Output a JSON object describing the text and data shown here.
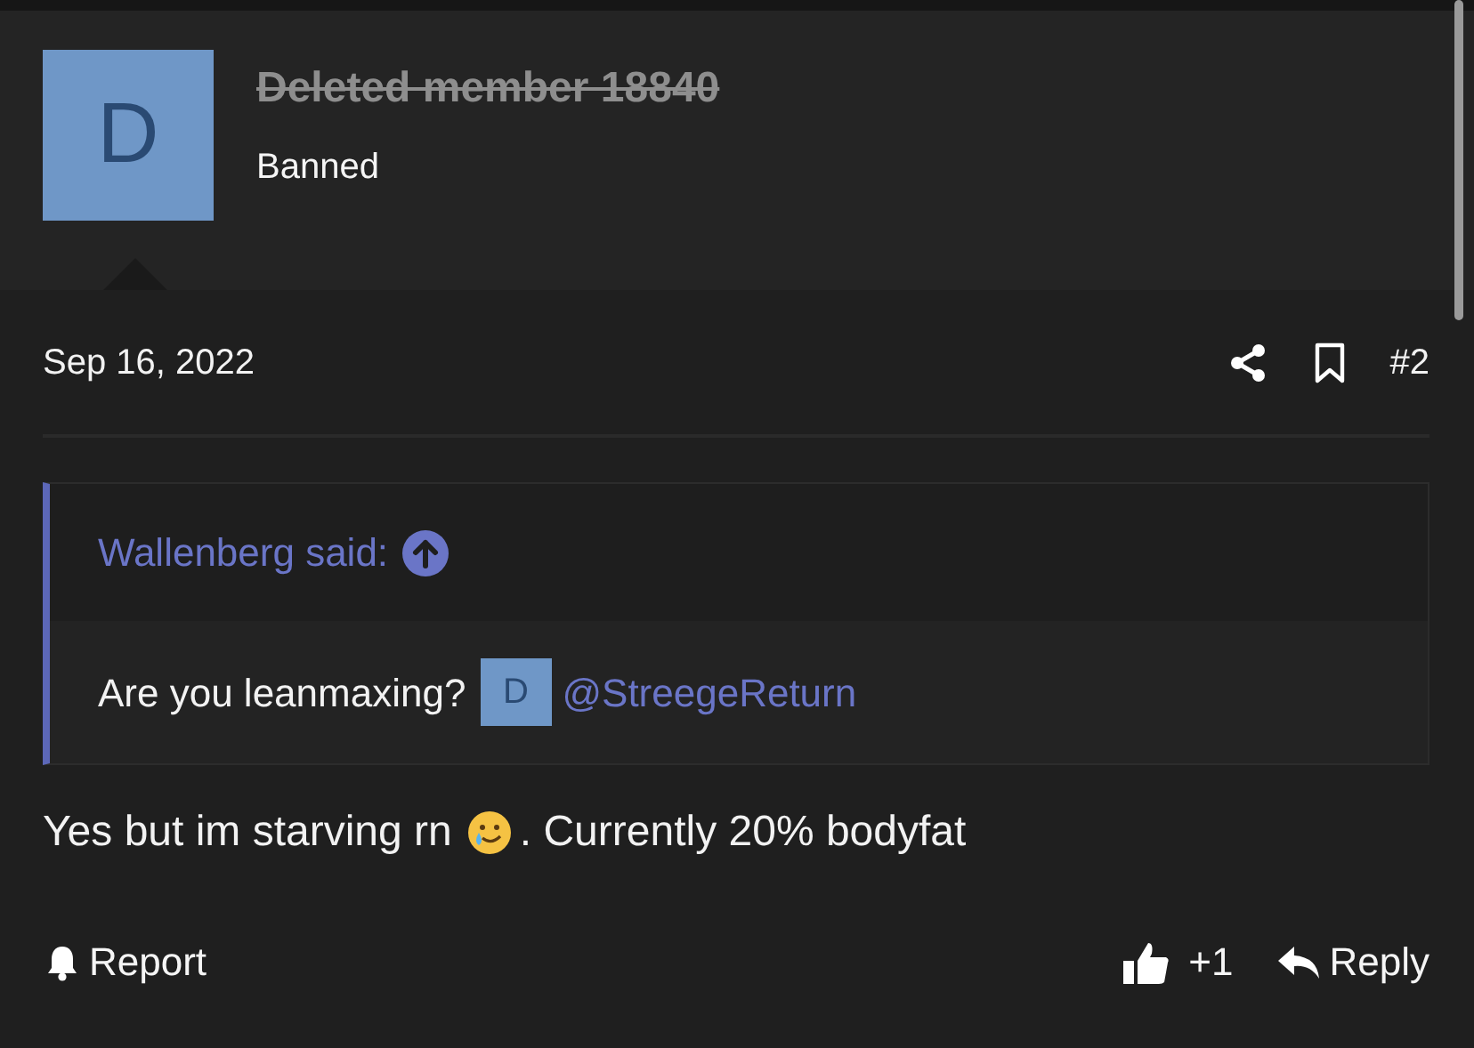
{
  "author": {
    "avatar_letter": "D",
    "name": "Deleted member 18840",
    "deleted": true,
    "role": "Banned"
  },
  "post": {
    "date": "Sep 16, 2022",
    "number": "#2"
  },
  "quote": {
    "attribution": "Wallenberg said:",
    "text": "Are you leanmaxing?",
    "mention_avatar_letter": "D",
    "mention": "@StreegeReturn"
  },
  "message": {
    "before_emoji": "Yes but im starving rn",
    "after_emoji": ". Currently 20% bodyfat"
  },
  "actions": {
    "report": "Report",
    "reaction_count": "+1",
    "reply": "Reply"
  }
}
